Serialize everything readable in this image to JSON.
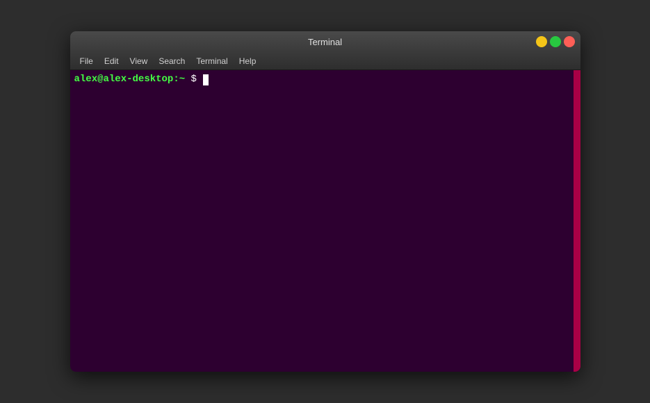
{
  "window": {
    "title": "Terminal",
    "controls": {
      "minimize_label": "−",
      "maximize_label": "□",
      "close_label": "×"
    }
  },
  "menubar": {
    "items": [
      {
        "label": "File"
      },
      {
        "label": "Edit"
      },
      {
        "label": "View"
      },
      {
        "label": "Search"
      },
      {
        "label": "Terminal"
      },
      {
        "label": "Help"
      }
    ]
  },
  "terminal": {
    "prompt_user": "alex@alex-desktop:~",
    "prompt_symbol": "$"
  },
  "colors": {
    "background": "#2d0030",
    "prompt_green": "#44ff44",
    "scrollbar": "#c0004a"
  }
}
